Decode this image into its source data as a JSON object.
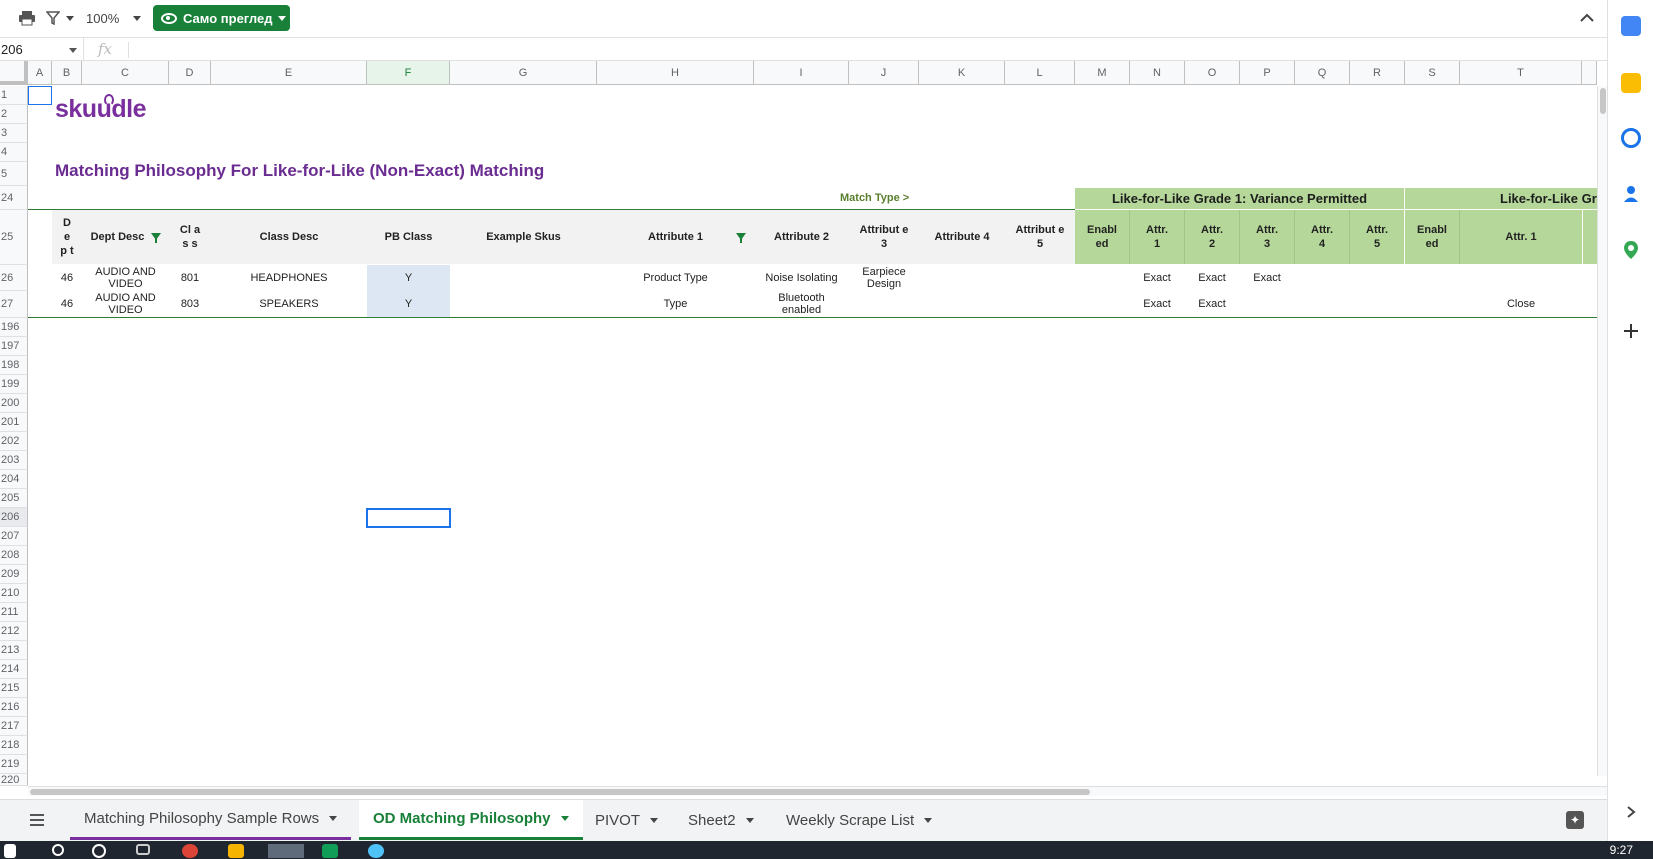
{
  "toolbar": {
    "zoom": "100%",
    "view_only_label": "Само преглед"
  },
  "formula_bar": {
    "name_box": "206",
    "fx": "fx",
    "value": ""
  },
  "columns": [
    "A",
    "B",
    "C",
    "D",
    "E",
    "F",
    "G",
    "H",
    "I",
    "J",
    "K",
    "L",
    "M",
    "N",
    "O",
    "P",
    "Q",
    "R",
    "S",
    "T"
  ],
  "rows": [
    "1",
    "2",
    "3",
    "4",
    "5",
    "24",
    "25",
    "26",
    "27",
    "196",
    "197",
    "198",
    "199",
    "200",
    "201",
    "202",
    "203",
    "204",
    "205",
    "206",
    "207",
    "208",
    "209",
    "210",
    "211",
    "212",
    "213",
    "214",
    "215",
    "216",
    "217",
    "218",
    "219",
    "220"
  ],
  "sheet": {
    "logo": "skuudle",
    "title": "Matching Philosophy For Like-for-Like (Non-Exact) Matching",
    "match_type_label": "Match Type >",
    "grade1_band": "Like-for-Like Grade 1: Variance Permitted",
    "grade2_band": "Like-for-Like Gra",
    "headers": {
      "dept": "D e p t",
      "dept_desc": "Dept Desc",
      "class": "Cl as s",
      "class_desc": "Class Desc",
      "pb_class": "PB Class",
      "example_skus": "Example Skus",
      "attr1": "Attribute 1",
      "attr2": "Attribute 2",
      "attr3": "Attribut e 3",
      "attr4": "Attribute 4",
      "attr5": "Attribut e 5",
      "g1_enabled": "Enabl ed",
      "g1_attr1": "Attr. 1",
      "g1_attr2": "Attr. 2",
      "g1_attr3": "Attr. 3",
      "g1_attr4": "Attr. 4",
      "g1_attr5": "Attr. 5",
      "g2_enabled": "Enabl ed",
      "g2_attr1": "Attr. 1"
    },
    "data_rows": [
      {
        "dept": "46",
        "dept_desc": "AUDIO AND VIDEO",
        "class": "801",
        "class_desc": "HEADPHONES",
        "pb_class": "Y",
        "attr1": "Product Type",
        "attr2": "Noise Isolating",
        "attr3": "Earpiece Design",
        "g1_attr1": "Exact",
        "g1_attr2": "Exact",
        "g1_attr3": "Exact",
        "g2_attr1": ""
      },
      {
        "dept": "46",
        "dept_desc": "AUDIO AND VIDEO",
        "class": "803",
        "class_desc": "SPEAKERS",
        "pb_class": "Y",
        "attr1": "Type",
        "attr2": "Bluetooth enabled",
        "attr3": "",
        "g1_attr1": "Exact",
        "g1_attr2": "Exact",
        "g1_attr3": "",
        "g2_attr1": "Close"
      }
    ]
  },
  "tabs": [
    {
      "label": "Matching Philosophy Sample Rows"
    },
    {
      "label": "OD Matching Philosophy"
    },
    {
      "label": "PIVOT"
    },
    {
      "label": "Sheet2"
    },
    {
      "label": "Weekly Scrape List"
    }
  ],
  "taskbar": {
    "clock": "9:27"
  },
  "colors": {
    "brand_purple": "#6a2c91",
    "sheets_green": "#188038",
    "band_green": "#b5d89a",
    "pb_blue": "#dde7f3"
  }
}
